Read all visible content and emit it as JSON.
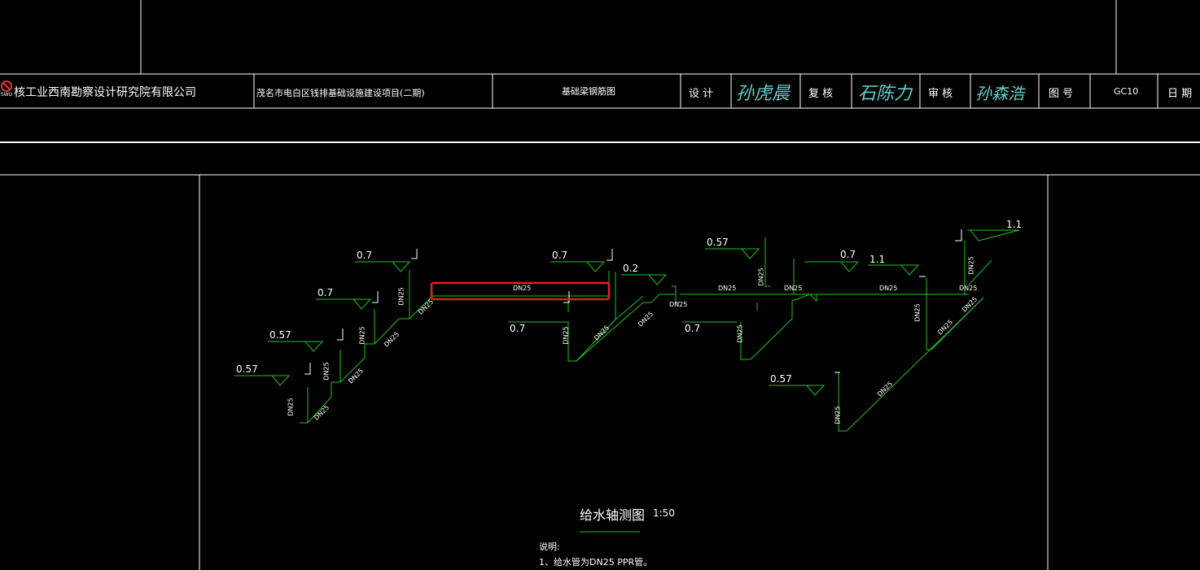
{
  "title_block": {
    "company": "核工业西南勘察设计研究院有限公司",
    "logo_text": "SWU",
    "project": "茂名市电白区钱排基础设施建设项目(二期)",
    "drawing_name": "基础梁钢筋图",
    "design_label": "设 计",
    "review_label": "复 核",
    "approve_label": "审 核",
    "drawing_no_label": "图 号",
    "drawing_no": "GC10",
    "date_label": "日 期",
    "sig_design": "孙虎晨",
    "sig_review": "石陈力",
    "sig_approve": "孙森浩"
  },
  "drawing": {
    "title": "给水轴测图",
    "scale": "1:50",
    "notes_heading": "说明:",
    "note_1": "1、给水管为DN25 PPR管。",
    "pipe_label": "DN25",
    "elevations": {
      "e1": "0.57",
      "e2": "0.57",
      "e3": "0.7",
      "e4": "0.7",
      "e5": "0.7",
      "e6": "0.7",
      "e7": "0.2",
      "e8": "0.57",
      "e9": "0.7",
      "e10": "0.7",
      "e11": "1.1",
      "e12": "1.1",
      "e13": "0.57"
    }
  },
  "colors": {
    "pipe": "#22c022",
    "highlight": "#e02020",
    "signature": "#5fd3d0",
    "line": "#ffffff"
  }
}
